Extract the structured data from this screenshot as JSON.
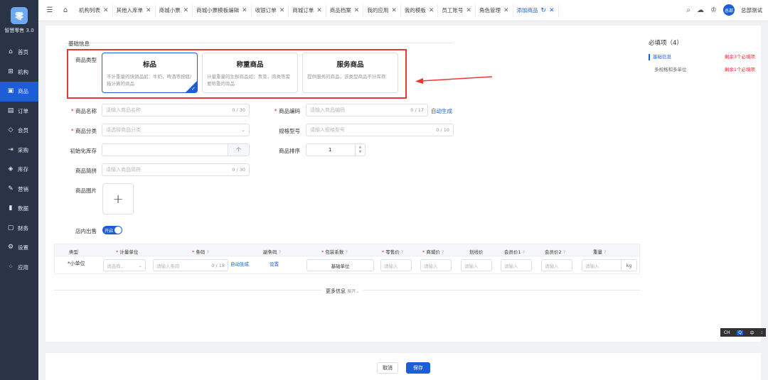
{
  "app": {
    "logo_char": "零",
    "brand": "智慧零售 3.0"
  },
  "nav": [
    {
      "icon": "home-icon",
      "glyph": "⌂",
      "label": "首页"
    },
    {
      "icon": "org-icon",
      "glyph": "⊞",
      "label": "机构"
    },
    {
      "icon": "goods-icon",
      "glyph": "▣",
      "label": "商品",
      "active": true
    },
    {
      "icon": "order-icon",
      "glyph": "▤",
      "label": "订单"
    },
    {
      "icon": "member-icon",
      "glyph": "◇",
      "label": "会员"
    },
    {
      "icon": "purchase-icon",
      "glyph": "⇥",
      "label": "采购"
    },
    {
      "icon": "stock-icon",
      "glyph": "◈",
      "label": "库存"
    },
    {
      "icon": "marketing-icon",
      "glyph": "✎",
      "label": "营销"
    },
    {
      "icon": "data-icon",
      "glyph": "▮",
      "label": "数据"
    },
    {
      "icon": "finance-icon",
      "glyph": "▢",
      "label": "财务"
    },
    {
      "icon": "settings-icon",
      "glyph": "⚙",
      "label": "设置"
    },
    {
      "icon": "apps-icon",
      "glyph": "⁘",
      "label": "应用"
    }
  ],
  "tabs": [
    {
      "label": "机构列表"
    },
    {
      "label": "其他入库单"
    },
    {
      "label": "商城小票"
    },
    {
      "label": "商城小票模板编辑"
    },
    {
      "label": "收银订单"
    },
    {
      "label": "商城订单"
    },
    {
      "label": "商品档案"
    },
    {
      "label": "我的应用"
    },
    {
      "label": "我的模板"
    },
    {
      "label": "员工账号"
    },
    {
      "label": "角色管理"
    },
    {
      "label": "添加商品",
      "active": true
    }
  ],
  "user": {
    "avatar": "总部",
    "name": "总部测试"
  },
  "form": {
    "section": "基础信息",
    "type_label": "商品类型",
    "types": [
      {
        "title": "标品",
        "desc": "不计重量的快销品如：牛奶，啤酒等按瓶/箱计算的商品",
        "selected": true
      },
      {
        "title": "称重商品",
        "desc": "计量重量的生鲜商品如：青菜，肉类等需要称重的商品"
      },
      {
        "title": "服务商品",
        "desc": "提供服务的商品，该类型商品不计库存"
      }
    ],
    "name_label": "商品名称",
    "name_ph": "请输入商品名称",
    "name_cnt": "0 / 30",
    "code_label": "商品编码",
    "code_ph": "请输入商品编码",
    "code_cnt": "0 / 17",
    "auto_gen": "自动生成",
    "cat_label": "商品分类",
    "cat_ph": "请选择商品分类",
    "spec_label": "规格型号",
    "spec_ph": "请输入规格型号",
    "spec_cnt": "0 / 10",
    "stock_label": "初始化库存",
    "stock_unit": "个",
    "sort_label": "商品排序",
    "sort_value": "1",
    "py_label": "商品简拼",
    "py_ph": "请输入商品简拼",
    "py_cnt": "0 / 30",
    "img_label": "商品图片",
    "store_label": "店内出售",
    "toggle_text": "开启",
    "more": "更多信息",
    "expand": "展开"
  },
  "table": {
    "headers": [
      "类型",
      "计量单位",
      "条码",
      "副条码",
      "包装系数",
      "零售价",
      "商城价",
      "划线价",
      "会员价1",
      "会员价2",
      "重量"
    ],
    "row": {
      "type": "*小单位",
      "unit_ph": "请选择...",
      "barcode_ph": "请输入条码",
      "barcode_cnt": "0 / 18",
      "auto": "自动生成",
      "sub": "设置",
      "pack": "基础单位",
      "price_ph": "请输入",
      "weight_unit": "kg"
    }
  },
  "required_panel": {
    "title": "必填项（4）",
    "items": [
      {
        "label": "基础信息",
        "note": "剩余3个必填项"
      },
      {
        "label": "多规格和多单位",
        "note": "剩余1个必填项"
      }
    ]
  },
  "footer": {
    "cancel": "取消",
    "save": "保存"
  },
  "ime": {
    "lang": "CH",
    "mode": "中"
  }
}
